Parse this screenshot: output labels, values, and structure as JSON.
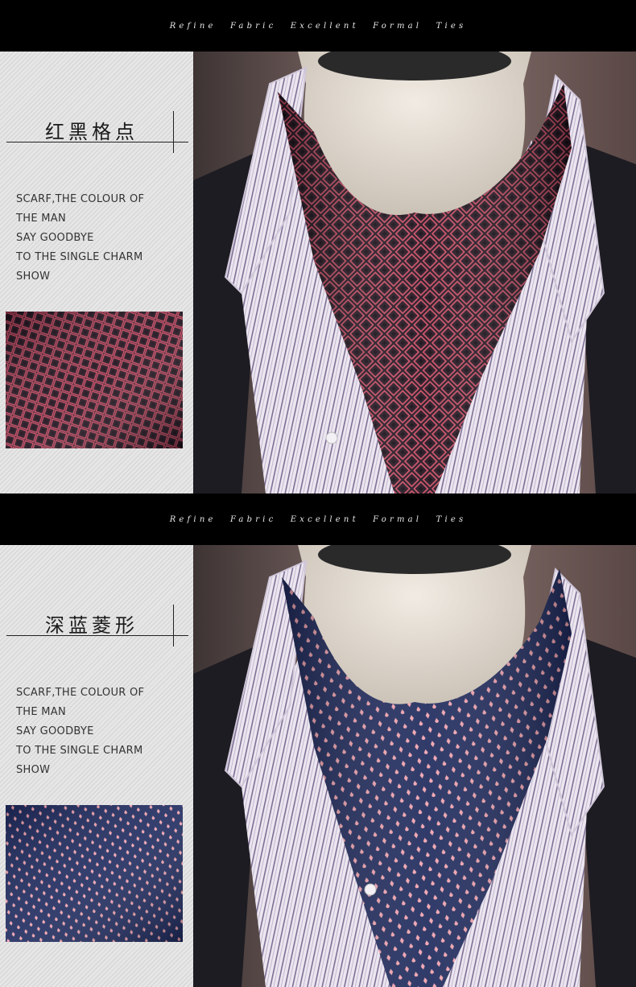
{
  "banner_text": "Refine Fabric Excellent Formal Ties",
  "sections": [
    {
      "title": "红黑格点",
      "description_lines": [
        "SCARF,THE COLOUR OF",
        "THE MAN",
        "SAY GOODBYE",
        "TO THE SINGLE CHARM",
        "SHOW"
      ],
      "scarf_color": "#2a1a26",
      "dot_color": "#e0566e",
      "pattern": "red-black-checker-dots"
    },
    {
      "title": "深蓝菱形",
      "description_lines": [
        "SCARF,THE COLOUR OF",
        "THE MAN",
        "SAY GOODBYE",
        "TO THE SINGLE CHARM",
        "SHOW"
      ],
      "scarf_color": "#1f2a5c",
      "dot_color": "#f2a4b0",
      "pattern": "navy-diamond-dots"
    }
  ]
}
